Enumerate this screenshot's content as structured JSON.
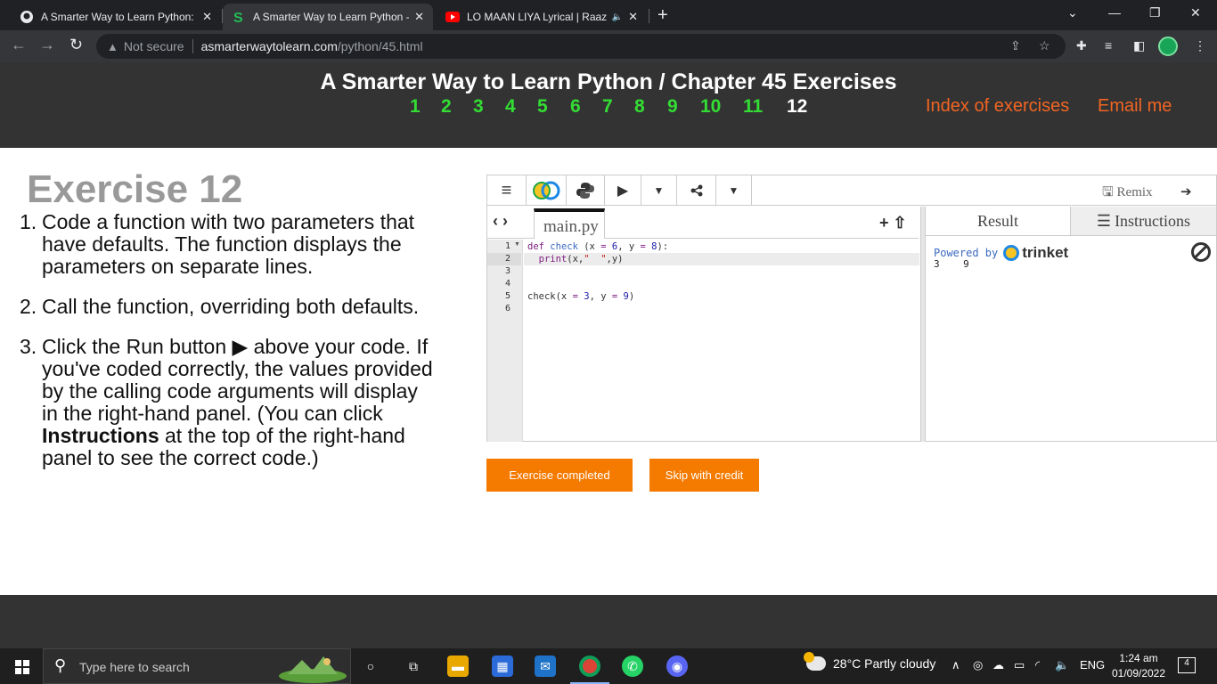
{
  "browser": {
    "tabs": [
      {
        "title": "A Smarter Way to Learn Python: E",
        "favicon": "github-icon",
        "active": false
      },
      {
        "title": "A Smarter Way to Learn Python - ",
        "favicon": "site-s-icon",
        "active": true
      },
      {
        "title": "LO MAAN LIYA Lyrical | Raaz",
        "favicon": "youtube-icon",
        "active": false,
        "playing_audio": true
      }
    ],
    "new_tab_symbol": "+",
    "security_label": "Not secure",
    "url_host": "asmarterwaytolearn.com",
    "url_path": "/python/45.html"
  },
  "site": {
    "title": "A Smarter Way to Learn Python / Chapter 45 Exercises",
    "exercise_numbers": [
      "1",
      "2",
      "3",
      "4",
      "5",
      "6",
      "7",
      "8",
      "9",
      "10",
      "11",
      "12"
    ],
    "current_exercise": "12",
    "index_link": "Index of exercises",
    "email_link": "Email me",
    "accent_color": "#f26522",
    "number_color": "#33dd33"
  },
  "exercise": {
    "title": "Exercise 12",
    "items": [
      {
        "num": "1.",
        "text": "Code a function with two parameters that have defaults. The function displays the parameters on separate lines."
      },
      {
        "num": "2.",
        "text": "Call the function, overriding both defaults."
      },
      {
        "num": "3.",
        "pre": "Click the Run button ▶ above your code. If you've coded correctly, the values provided by the calling code arguments will display in the right-hand panel. (You can click ",
        "bold": "Instructions",
        "post": " at the top of the right-hand panel to see the correct code.)"
      }
    ]
  },
  "trinket": {
    "toolbar_icons": [
      "menu-icon",
      "trinket-logo-icon",
      "python-icon",
      "run-icon",
      "dropdown-icon",
      "share-icon",
      "dropdown-icon"
    ],
    "remix_label": "Remix",
    "file_name": "main.py",
    "line_numbers": [
      "1",
      "2",
      "3",
      "4",
      "5",
      "6"
    ],
    "code_lines": [
      "def check (x = 6, y = 8):",
      "  print(x,\"  \",y)",
      "",
      "",
      "check(x = 3, y = 9)",
      ""
    ],
    "result_tab": "Result",
    "instructions_tab": "Instructions",
    "powered_by": "Powered by",
    "brand": "trinket",
    "output": "3    9"
  },
  "buttons": {
    "completed": "Exercise completed",
    "skip": "Skip with credit"
  },
  "taskbar": {
    "search_placeholder": "Type here to search",
    "weather": "28°C  Partly cloudy",
    "language": "ENG",
    "time": "1:24 am",
    "date": "01/09/2022",
    "notification_count": "4"
  }
}
